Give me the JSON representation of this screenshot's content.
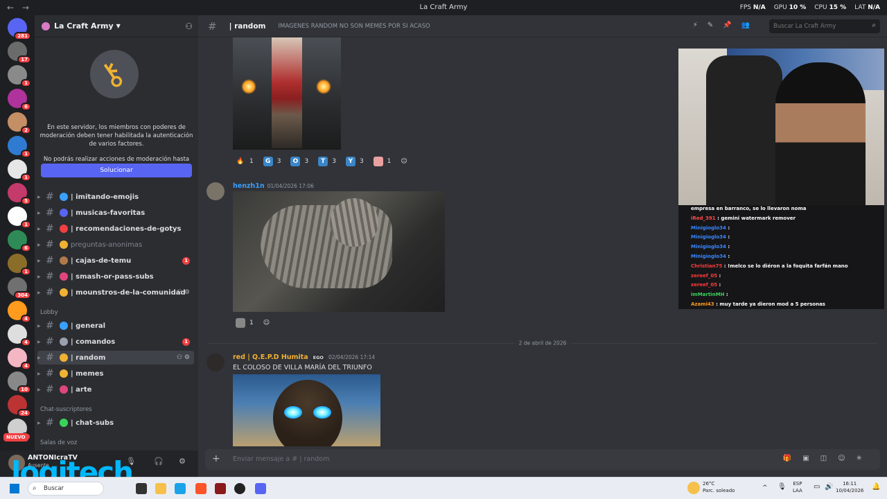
{
  "titlebar": {
    "title": "La Craft Army",
    "fps_label": "FPS",
    "fps_value": "N/A",
    "gpu_label": "GPU",
    "gpu_value": "10 %",
    "cpu_label": "CPU",
    "cpu_value": "15 %",
    "lat_label": "LAT",
    "lat_value": "N/A"
  },
  "servers": [
    {
      "badge": "281",
      "color": "#5865f2"
    },
    {
      "badge": "17",
      "color": "#6b6b6b"
    },
    {
      "badge": "1",
      "color": "#8a8a8a"
    },
    {
      "badge": "6",
      "color": "#b0329c"
    },
    {
      "badge": "2",
      "color": "#c58f65"
    },
    {
      "badge": "1",
      "color": "#2f7bd1"
    },
    {
      "badge": "1",
      "color": "#e6e6e6"
    },
    {
      "badge": "5",
      "color": "#c43a6a"
    },
    {
      "badge": "1",
      "color": "#ffffff"
    },
    {
      "badge": "6",
      "color": "#2e8b57"
    },
    {
      "badge": "1",
      "color": "#8b6d2a"
    },
    {
      "badge": "304",
      "color": "#707070"
    },
    {
      "badge": "4",
      "color": "#ff9b1d"
    },
    {
      "badge": "4",
      "color": "#dedede"
    },
    {
      "badge": "4",
      "color": "#f4b6c2"
    },
    {
      "badge": "10",
      "color": "#888888"
    },
    {
      "badge": "24",
      "color": "#b33"
    },
    {
      "badge": "4",
      "color": "#cfcfcf"
    },
    {
      "badge": "15",
      "color": "#d9822b"
    }
  ],
  "nuevo_label": "NUEVO",
  "guild": {
    "name": "La Craft Army"
  },
  "notice": {
    "text1": "En este servidor, los miembros con poderes de moderación deben tener habilitada la autenticación de varios factores.",
    "text2": "No podrás realizar acciones de moderación hasta que no la hayas habilitado.",
    "button": "Solucionar"
  },
  "channels_top": [
    {
      "name": "| imitando-emojis",
      "emo": "#3aa0ff",
      "muted": false
    },
    {
      "name": "| musicas-favoritas",
      "emo": "#5865f2",
      "muted": false
    },
    {
      "name": "| recomendaciones-de-gotys",
      "emo": "#f23f42",
      "muted": false
    },
    {
      "name": "preguntas-anonimas",
      "emo": "#f0b232",
      "muted": true
    },
    {
      "name": "| cajas-de-temu",
      "emo": "#b07a4a",
      "muted": false,
      "badge": "1"
    },
    {
      "name": "| smash-or-pass-subs",
      "emo": "#e0457b",
      "muted": false
    },
    {
      "name": "| mounstros-de-la-comunidad",
      "emo": "#f0b232",
      "muted": false
    }
  ],
  "category_lobby": "Lobby",
  "channels_lobby": [
    {
      "name": "| general",
      "emo": "#3aa0ff",
      "badge": ""
    },
    {
      "name": "| comandos",
      "emo": "#9aa0b0",
      "badge": "1"
    },
    {
      "name": "| random",
      "emo": "#f0b232",
      "badge": ""
    },
    {
      "name": "| memes",
      "emo": "#f0b232",
      "badge": ""
    },
    {
      "name": "| arte",
      "emo": "#e0457b",
      "badge": ""
    }
  ],
  "category_subs": "Chat-suscriptores",
  "channel_subs": "| chat-subs",
  "category_voice": "Salas de voz",
  "user": {
    "name": "ANTONIcraTV",
    "status": "Ausente"
  },
  "logo_text": "logitech",
  "header": {
    "channel": "| random",
    "topic": "IMAGENES RANDOM NO SON MEMES POR SI ACASO",
    "search_placeholder": "Buscar La Craft Army"
  },
  "reactions": [
    {
      "emoji": "🔥",
      "count": "1",
      "bg": "transparent",
      "label": ""
    },
    {
      "emoji": "G",
      "count": "3",
      "bg": "#3a86c8",
      "label": "G"
    },
    {
      "emoji": "O",
      "count": "3",
      "bg": "#3a86c8",
      "label": "O"
    },
    {
      "emoji": "T",
      "count": "3",
      "bg": "#3a86c8",
      "label": "T"
    },
    {
      "emoji": "Y",
      "count": "3",
      "bg": "#3a86c8",
      "label": "Y"
    },
    {
      "emoji": "",
      "count": "1",
      "bg": "#e9a0a0",
      "label": ""
    }
  ],
  "message2": {
    "author": "henzh1n",
    "timestamp": "01/04/2026 17:06",
    "reaction_count": "1"
  },
  "date_divider": "2 de abril de 2026",
  "message3": {
    "author": "red | Q.E.P.D Humita",
    "tag": "EGO",
    "timestamp": "02/04/2026 17:14",
    "text": "EL COLOSO DE VILLA MARÍA DEL TRIUNFO"
  },
  "composer": {
    "placeholder": "Enviar mensaje a #",
    "channel": "| random"
  },
  "stream_chat": [
    {
      "user": "",
      "text": "empresa en barranco, se lo llevaron noma",
      "ucolor": "#ffffff"
    },
    {
      "user": "iRed_391",
      "text": ": gemini watermark remover",
      "ucolor": "#ff4a4a"
    },
    {
      "user": "Minigioglo34",
      "text": ":",
      "ucolor": "#3a86ff"
    },
    {
      "user": "Minigioglo34",
      "text": ":",
      "ucolor": "#3a86ff"
    },
    {
      "user": "Minigioglo34",
      "text": ":",
      "ucolor": "#3a86ff"
    },
    {
      "user": "Minigioglo34",
      "text": ":",
      "ucolor": "#3a86ff"
    },
    {
      "user": "Christian75",
      "text": ": !melco se lo diéron a la foquita farfán mano",
      "ucolor": "#ff3b3b"
    },
    {
      "user": "zereef_05",
      "text": ":",
      "ucolor": "#ff3b3b"
    },
    {
      "user": "zereef_05",
      "text": ":",
      "ucolor": "#ff3b3b"
    },
    {
      "user": "imMartinMH",
      "text": ":",
      "ucolor": "#3ad35a"
    },
    {
      "user": "Azami43",
      "text": ": muy tarde ya dieron mod a 5 personas",
      "ucolor": "#ff9b1d"
    }
  ],
  "taskbar": {
    "search": "Buscar",
    "temp": "26°C",
    "weather": "Parc. soleado",
    "lang1": "ESP",
    "lang2": "LAA",
    "time": "16:11",
    "date": "10/04/2026"
  }
}
